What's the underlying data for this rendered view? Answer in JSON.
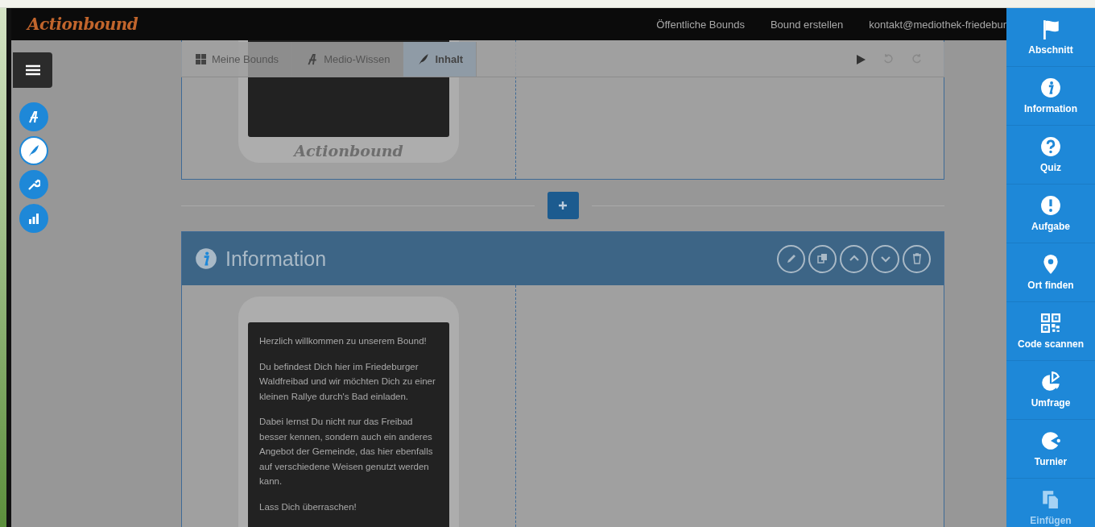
{
  "header": {
    "logo": "Actionbound",
    "nav": [
      "Öffentliche Bounds",
      "Bound erstellen",
      "kontakt@mediothek-friedebur"
    ]
  },
  "side_nav": [
    {
      "kind": "bound",
      "selected": false
    },
    {
      "kind": "content",
      "selected": true
    },
    {
      "kind": "settings",
      "selected": false
    },
    {
      "kind": "stats",
      "selected": false
    }
  ],
  "breadcrumb": [
    {
      "label": "Meine Bounds",
      "kind": "grid",
      "selected": false
    },
    {
      "label": "Medio-Wissen",
      "kind": "bound",
      "selected": false
    },
    {
      "label": "Inhalt",
      "kind": "content",
      "selected": true
    }
  ],
  "phone_brand": "Actionbound",
  "element": {
    "title": "Information",
    "paragraphs": [
      "Herzlich willkommen zu unserem Bound!",
      "Du befindest Dich hier im Friedeburger Waldfreibad und wir möchten Dich zu einer kleinen Rallye durch's Bad einladen.",
      "Dabei lernst Du nicht nur das Freibad besser kennen, sondern auch ein anderes Angebot der Gemeinde, das hier ebenfalls auf verschiedene Weisen genutzt werden kann.",
      "Lass Dich überraschen!"
    ]
  },
  "toolbox": [
    {
      "label": "Abschnitt",
      "kind": "flag",
      "disabled": false
    },
    {
      "label": "Information",
      "kind": "info",
      "disabled": false
    },
    {
      "label": "Quiz",
      "kind": "quiz",
      "disabled": false
    },
    {
      "label": "Aufgabe",
      "kind": "task",
      "disabled": false
    },
    {
      "label": "Ort finden",
      "kind": "location",
      "disabled": false
    },
    {
      "label": "Code scannen",
      "kind": "qr",
      "disabled": false
    },
    {
      "label": "Umfrage",
      "kind": "poll",
      "disabled": false
    },
    {
      "label": "Turnier",
      "kind": "tournament",
      "disabled": false
    },
    {
      "label": "Einfügen",
      "kind": "paste",
      "disabled": true
    }
  ]
}
